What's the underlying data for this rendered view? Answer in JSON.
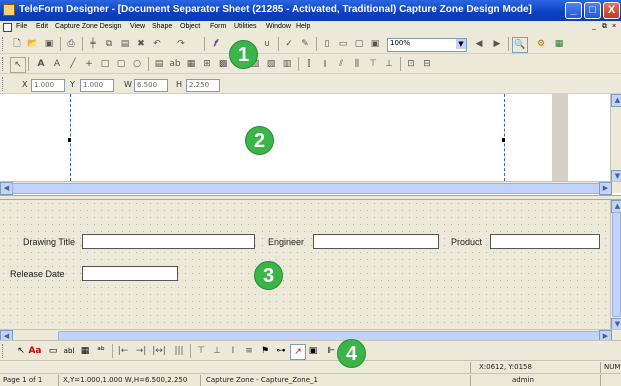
{
  "window": {
    "title": "TeleForm Designer - [Document Separator Sheet (21285 - Activated, Traditional)  Capture Zone Design Mode]",
    "controls": {
      "minimize": "_",
      "maximize": "□",
      "close": "X"
    }
  },
  "menu": {
    "items": [
      "File",
      "Edit",
      "Capture Zone Design",
      "View",
      "Shape",
      "Object",
      "Form",
      "Utilities",
      "Window",
      "Help"
    ],
    "mdi_controls": {
      "minimize": "_",
      "restore": "⧉",
      "close": "×"
    }
  },
  "toolbar1": {
    "zoom_value": "100%"
  },
  "coords": {
    "x_label": "X",
    "x_value": "1.000",
    "y_label": "Y",
    "y_value": "1.000",
    "w_label": "W",
    "w_value": "6.500",
    "h_label": "H",
    "h_value": "2.250"
  },
  "callouts": [
    "1",
    "2",
    "3",
    "4"
  ],
  "form": {
    "fields": [
      {
        "label": "Drawing Title"
      },
      {
        "label": "Engineer"
      },
      {
        "label": "Product"
      },
      {
        "label": "Release Date"
      }
    ]
  },
  "status": {
    "cursor": "X:0612, Y:0158",
    "num": "NUM",
    "page": "Page 1 of 1",
    "dims": "X,Y=1.000,1.000  W,H=6.500,2.250",
    "zone": "Capture Zone - Capture_Zone_1",
    "user": "admin"
  },
  "icons": {
    "toolbar1": [
      "new-doc-icon",
      "open-folder-icon",
      "save-icon",
      "print-icon",
      "grid-icon",
      "copy-icon",
      "paste-icon",
      "delete-icon",
      "undo-icon",
      "redo-icon",
      "italic-icon",
      "underline-icon",
      "check-icon",
      "page-icon",
      "page-fit-icon",
      "page-width-icon",
      "prev-icon",
      "next-icon",
      "zoom-tool-icon",
      "wizard-icon",
      "chart-icon"
    ],
    "toolbar2": [
      "select-icon",
      "text-icon",
      "italic-text-icon",
      "line-icon",
      "plus-icon",
      "rect-icon",
      "round-rect-icon",
      "ellipse-icon",
      "field-icon",
      "ab-icon",
      "table-icon",
      "align-left-icon",
      "align-center-icon",
      "align-right-icon",
      "distribute-icon",
      "group-icon"
    ],
    "drawbar": [
      "pointer-icon",
      "text-tool-icon",
      "box-tool-icon",
      "abl-icon",
      "grid-tool-icon",
      "ab-tool-icon",
      "arrow-right-icon",
      "arrow-right2-icon",
      "bracket-icon",
      "bars-icon",
      "top-align-icon",
      "bottom-align-icon",
      "center-align-icon",
      "equal-icon",
      "flag-icon",
      "lookup-icon",
      "chart-tool-icon",
      "properties-icon",
      "tree-icon"
    ]
  }
}
